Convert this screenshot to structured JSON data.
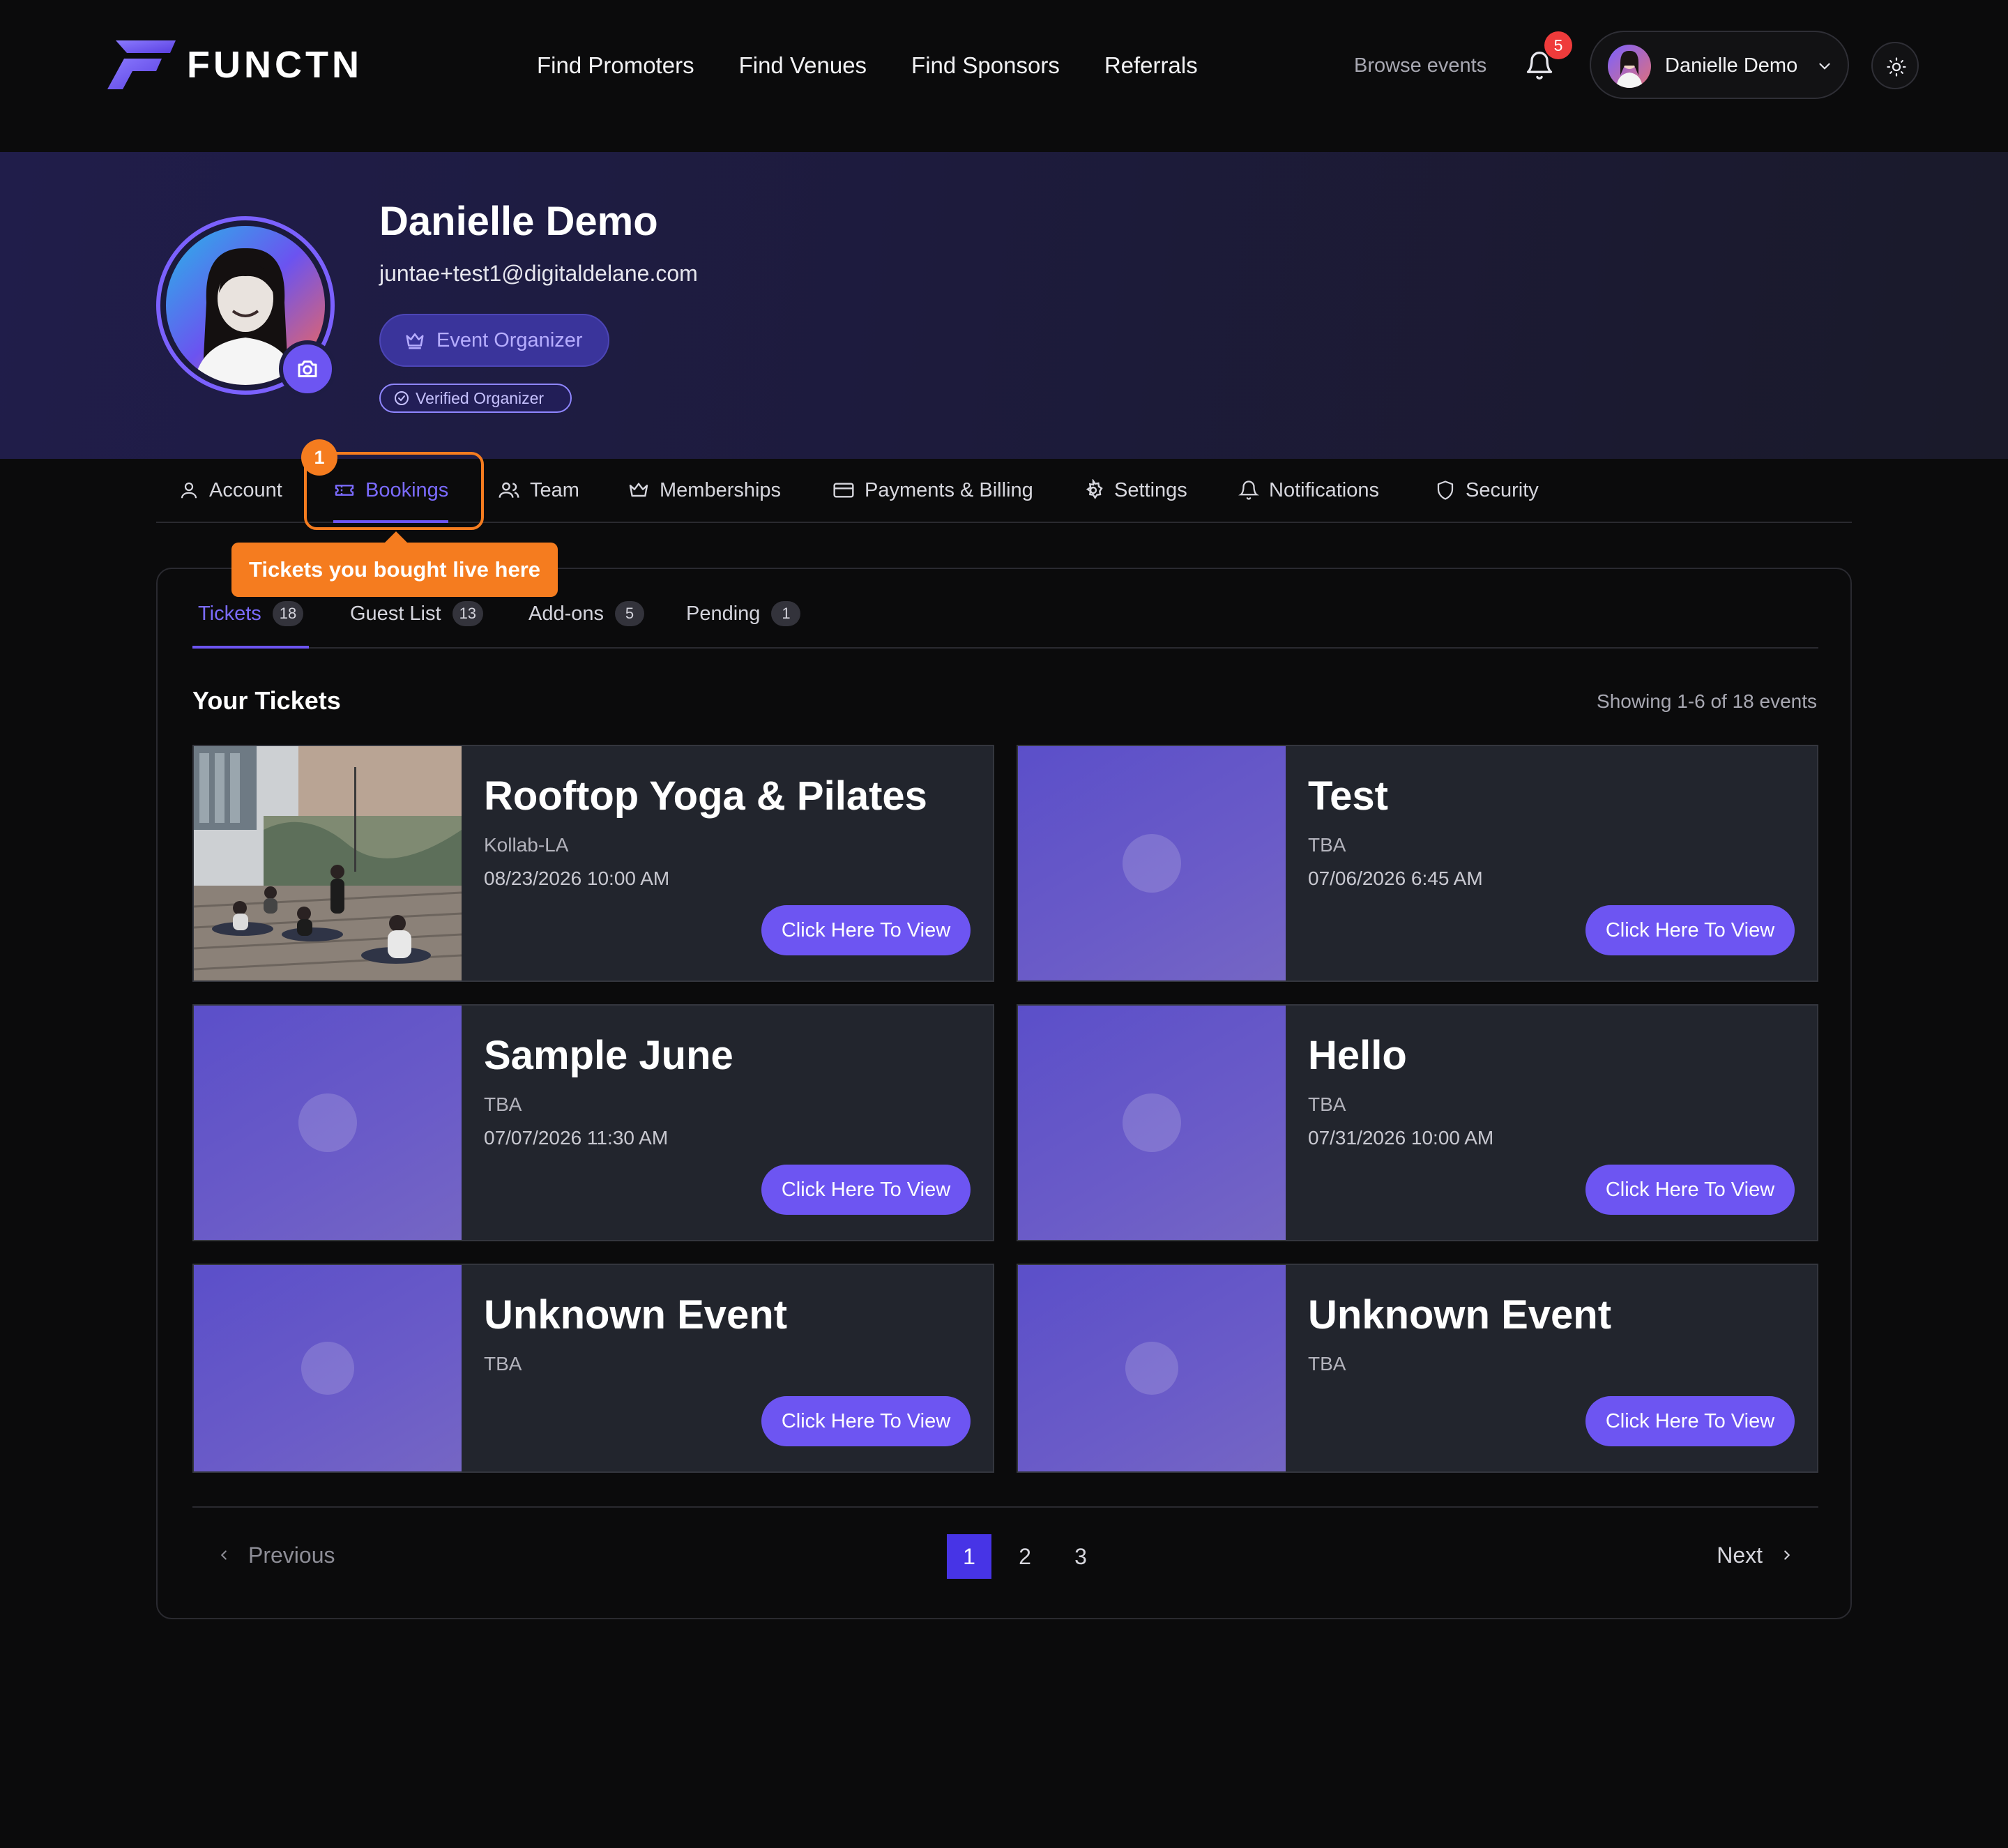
{
  "brand": {
    "name": "FUNCTN",
    "accent": "#6d55f2",
    "highlight": "#f57c1f"
  },
  "nav": {
    "links": [
      "Find Promoters",
      "Find Venues",
      "Find Sponsors",
      "Referrals"
    ],
    "browse": "Browse events",
    "notification_count": "5",
    "user_name": "Danielle Demo"
  },
  "profile": {
    "name": "Danielle Demo",
    "email": "juntae+test1@digitaldelane.com",
    "role": "Event Organizer",
    "verified": "Verified Organizer"
  },
  "tabs": [
    {
      "label": "Account",
      "icon": "user-icon"
    },
    {
      "label": "Bookings",
      "icon": "ticket-icon"
    },
    {
      "label": "Team",
      "icon": "users-icon"
    },
    {
      "label": "Memberships",
      "icon": "crown-icon"
    },
    {
      "label": "Payments & Billing",
      "icon": "card-icon"
    },
    {
      "label": "Settings",
      "icon": "gear-icon"
    },
    {
      "label": "Notifications",
      "icon": "bell-icon"
    },
    {
      "label": "Security",
      "icon": "shield-icon"
    }
  ],
  "tour": {
    "step": "1",
    "tooltip": "Tickets you bought live here"
  },
  "subtabs": [
    {
      "label": "Tickets",
      "count": "18"
    },
    {
      "label": "Guest List",
      "count": "13"
    },
    {
      "label": "Add-ons",
      "count": "5"
    },
    {
      "label": "Pending",
      "count": "1"
    }
  ],
  "section": {
    "title": "Your Tickets",
    "showing": "Showing 1-6 of 18 events"
  },
  "tickets": [
    {
      "title": "Rooftop Yoga & Pilates",
      "venue": "Kollab-LA",
      "date": "08/23/2026 10:00 AM",
      "button": "Click Here To View"
    },
    {
      "title": "Test",
      "venue": "TBA",
      "date": "07/06/2026 6:45 AM",
      "button": "Click Here To View"
    },
    {
      "title": "Sample June",
      "venue": "TBA",
      "date": "07/07/2026 11:30 AM",
      "button": "Click Here To View"
    },
    {
      "title": "Hello",
      "venue": "TBA",
      "date": "07/31/2026 10:00 AM",
      "button": "Click Here To View"
    },
    {
      "title": "Unknown Event",
      "venue": "TBA",
      "date": "",
      "button": "Click Here To View"
    },
    {
      "title": "Unknown Event",
      "venue": "TBA",
      "date": "",
      "button": "Click Here To View"
    }
  ],
  "pagination": {
    "previous": "Previous",
    "next": "Next",
    "pages": [
      "1",
      "2",
      "3"
    ],
    "current": "1"
  }
}
